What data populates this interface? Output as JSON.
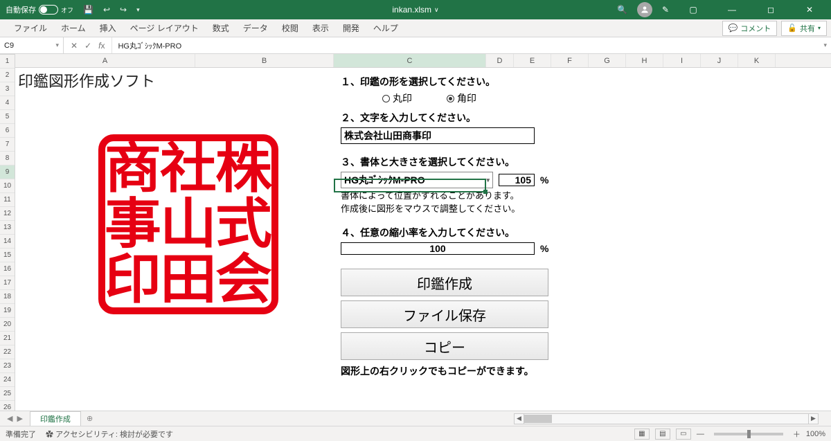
{
  "titlebar": {
    "autosave_label": "自動保存",
    "autosave_state": "オフ",
    "filename": "inkan.xlsm"
  },
  "ribbon": {
    "tabs": [
      "ファイル",
      "ホーム",
      "挿入",
      "ページ レイアウト",
      "数式",
      "データ",
      "校閲",
      "表示",
      "開発",
      "ヘルプ"
    ],
    "comment_btn": "コメント",
    "share_btn": "共有"
  },
  "formula_bar": {
    "cell_ref": "C9",
    "formula": "HG丸ｺﾞｼｯｸM-PRO"
  },
  "columns": {
    "labels": [
      "A",
      "B",
      "C",
      "D",
      "E",
      "F",
      "G",
      "H",
      "I",
      "J",
      "K"
    ],
    "widths": [
      260,
      200,
      220,
      40,
      54,
      54,
      54,
      54,
      54,
      54,
      54
    ]
  },
  "row_count": 27,
  "selection": {
    "row": 9,
    "col": "C"
  },
  "app": {
    "title": "印鑑図形作成ソフト",
    "stamp_chars": [
      "株",
      "式",
      "会",
      "社",
      "山",
      "田",
      "商",
      "事",
      "印"
    ],
    "step1_label": "１、印鑑の形を選択してください。",
    "radio_round": "丸印",
    "radio_square": "角印",
    "radio_selected": "square",
    "step2_label": "２、文字を入力してください。",
    "text_input": "株式会社山田商事印",
    "step3_label": "３、書体と大きさを選択してください。",
    "font_value": "HG丸ｺﾞｼｯｸM-PRO",
    "size_pct": "105",
    "pct_sign": "%",
    "note1": "書体によって位置がずれることがあります。",
    "note2": "作成後に図形をマウスで調整してください。",
    "step4_label": "４、任意の縮小率を入力してください。",
    "scale_pct": "100",
    "btn_create": "印鑑作成",
    "btn_save": "ファイル保存",
    "btn_copy": "コピー",
    "hint": "図形上の右クリックでもコピーができます。"
  },
  "sheet_tab": "印鑑作成",
  "statusbar": {
    "ready": "準備完了",
    "accessibility": "アクセシビリティ: 検討が必要です",
    "zoom": "100%"
  }
}
